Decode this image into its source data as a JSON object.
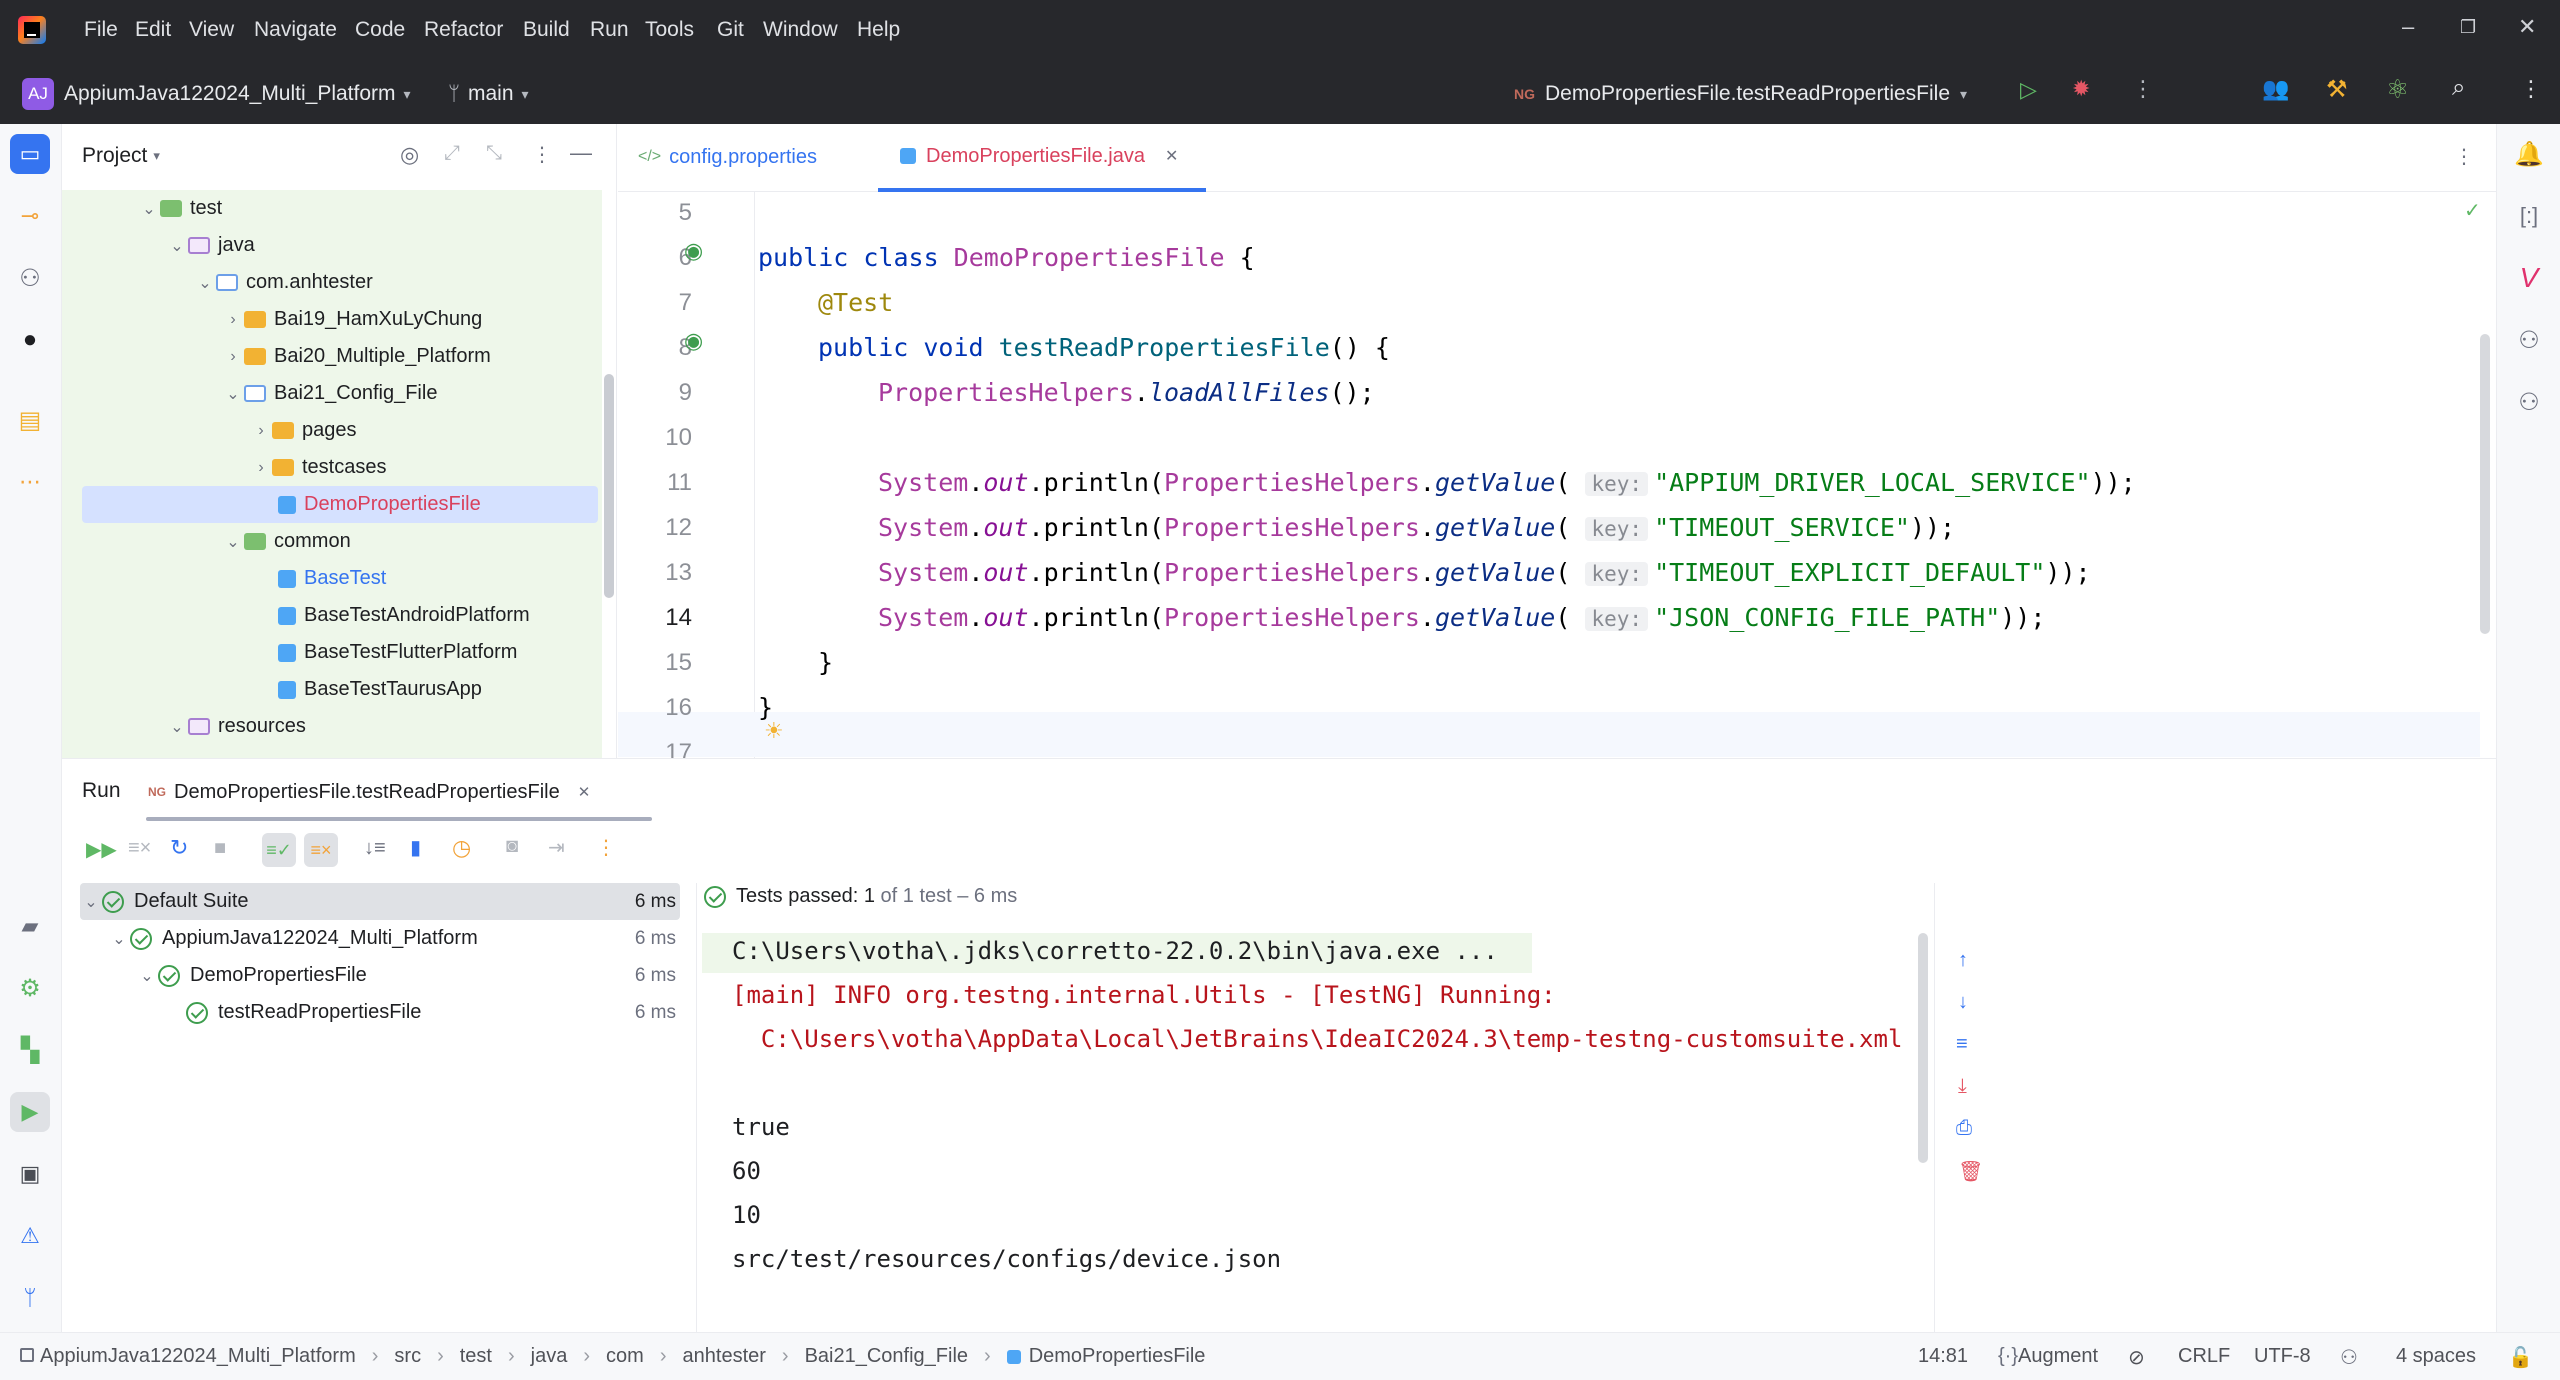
{
  "menu": [
    "File",
    "Edit",
    "View",
    "Navigate",
    "Code",
    "Refactor",
    "Build",
    "Run",
    "Tools",
    "Git",
    "Window",
    "Help"
  ],
  "project": {
    "badge": "AJ",
    "name": "AppiumJava122024_Multi_Platform",
    "branch": "main"
  },
  "run_config": {
    "badge": "NG",
    "name": "DemoPropertiesFile.testReadPropertiesFile"
  },
  "project_pane": {
    "title": "Project",
    "items": [
      {
        "label": "test",
        "kind": "test-root"
      },
      {
        "label": "java",
        "kind": "src"
      },
      {
        "label": "com.anhtester",
        "kind": "package"
      },
      {
        "label": "Bai19_HamXuLyChung",
        "kind": "folder"
      },
      {
        "label": "Bai20_Multiple_Platform",
        "kind": "folder"
      },
      {
        "label": "Bai21_Config_File",
        "kind": "package-open"
      },
      {
        "label": "pages",
        "kind": "folder"
      },
      {
        "label": "testcases",
        "kind": "folder"
      },
      {
        "label": "DemoPropertiesFile",
        "kind": "class-selected"
      },
      {
        "label": "common",
        "kind": "package-open"
      },
      {
        "label": "BaseTest",
        "kind": "class-blue"
      },
      {
        "label": "BaseTestAndroidPlatform",
        "kind": "class"
      },
      {
        "label": "BaseTestFlutterPlatform",
        "kind": "class"
      },
      {
        "label": "BaseTestTaurusApp",
        "kind": "class"
      },
      {
        "label": "resources",
        "kind": "resources"
      }
    ]
  },
  "editor": {
    "tabs": [
      {
        "label": "config.properties",
        "active": false
      },
      {
        "label": "DemoPropertiesFile.java",
        "active": true
      }
    ],
    "line_numbers": [
      "5",
      "6",
      "7",
      "8",
      "9",
      "10",
      "11",
      "12",
      "13",
      "14",
      "15",
      "16",
      "17"
    ],
    "code": {
      "l6_kw": "public class ",
      "l6_cls": "DemoPropertiesFile",
      " l6_rest": " {",
      "l6_rest": " {",
      "l7": "@Test",
      "l8_kw": "public void ",
      "l8_fn": "testReadPropertiesFile",
      "l8_rest": "() {",
      "l9_cls": "PropertiesHelpers",
      "l9_dot": ".",
      "l9_fn": "loadAllFiles",
      "l9_rest": "();",
      "sys": "System",
      "dot": ".",
      "out": "out",
      "println": ".println(",
      "helpers": "PropertiesHelpers",
      "getValue": "getValue",
      "paren": "(",
      "hint": "key:",
      "keys": [
        "\"APPIUM_DRIVER_LOCAL_SERVICE\"",
        "\"TIMEOUT_SERVICE\"",
        "\"TIMEOUT_EXPLICIT_DEFAULT\"",
        "\"JSON_CONFIG_FILE_PATH\""
      ],
      "close": "));",
      "brace": "}"
    }
  },
  "run": {
    "label": "Run",
    "tab": "DemoPropertiesFile.testReadPropertiesFile",
    "tree": [
      {
        "label": "Default Suite",
        "ms": "6 ms"
      },
      {
        "label": "AppiumJava122024_Multi_Platform",
        "ms": "6 ms"
      },
      {
        "label": "DemoPropertiesFile",
        "ms": "6 ms"
      },
      {
        "label": "testReadPropertiesFile",
        "ms": "6 ms"
      }
    ],
    "status_prefix": "Tests passed: ",
    "status_count": "1",
    "status_suffix": " of 1 test – 6 ms",
    "console": [
      "C:\\Users\\votha\\.jdks\\corretto-22.0.2\\bin\\java.exe ...",
      "[main] INFO org.testng.internal.Utils - [TestNG] Running:",
      "  C:\\Users\\votha\\AppData\\Local\\JetBrains\\IdeaIC2024.3\\temp-testng-customsuite.xml",
      "",
      "true",
      "60",
      "10",
      "src/test/resources/configs/device.json"
    ]
  },
  "statusbar": {
    "crumbs": [
      "AppiumJava122024_Multi_Platform",
      "src",
      "test",
      "java",
      "com",
      "anhtester",
      "Bai21_Config_File",
      "DemoPropertiesFile"
    ],
    "position": "14:81",
    "augment": "Augment",
    "line_sep": "CRLF",
    "encoding": "UTF-8",
    "indent": "4 spaces"
  },
  "colors": {
    "accent": "#3574f0",
    "selected_row": "#d5e1ff",
    "pass_green": "#3e9d4e",
    "console_red": "#b8141c",
    "module_bg": "#e8f5e4"
  }
}
